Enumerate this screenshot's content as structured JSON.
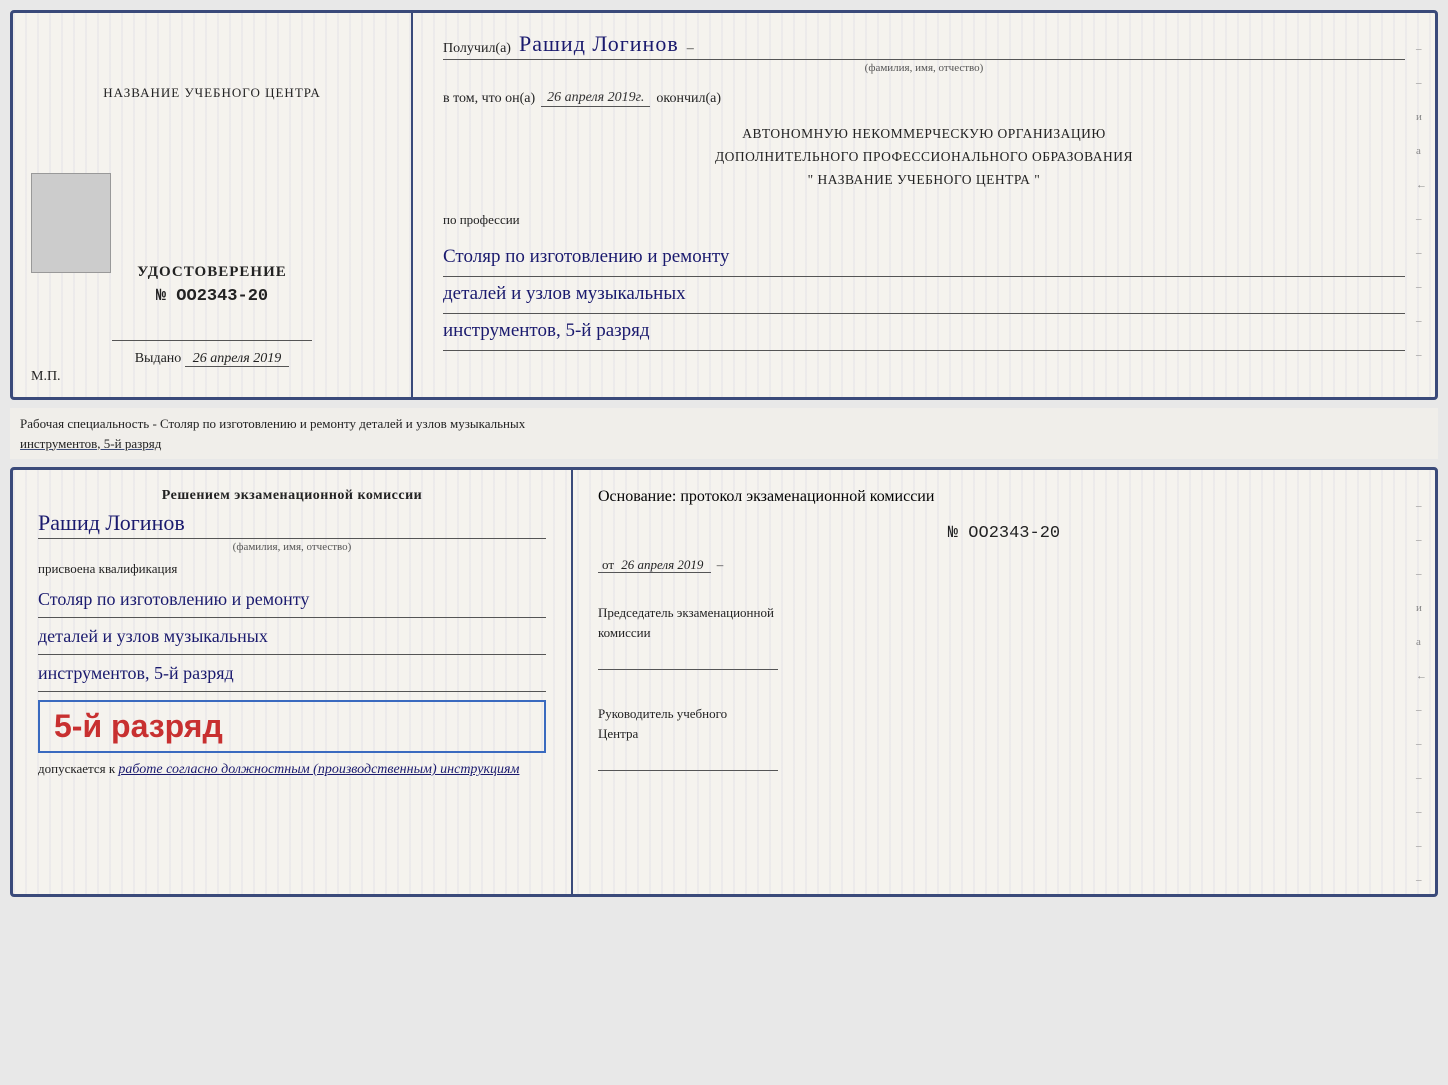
{
  "top_doc": {
    "left": {
      "center_title": "НАЗВАНИЕ УЧЕБНОГО ЦЕНТРА",
      "udostoverenie_label": "УДОСТОВЕРЕНИЕ",
      "number": "№ OO2343-20",
      "vydano_label": "Выдано",
      "vydano_date": "26 апреля 2019",
      "mp_label": "М.П."
    },
    "right": {
      "poluchil_prefix": "Получил(а)",
      "recipient_name": "Рашид Логинов",
      "fio_label": "(фамилия, имя, отчество)",
      "vtom_prefix": "в том, что он(а)",
      "date_value": "26 апреля 2019г.",
      "okonchil_label": "окончил(а)",
      "org_line1": "АВТОНОМНУЮ НЕКОММЕРЧЕСКУЮ ОРГАНИЗАЦИЮ",
      "org_line2": "ДОПОЛНИТЕЛЬНОГО ПРОФЕССИОНАЛЬНОГО ОБРАЗОВАНИЯ",
      "org_name": "\"  НАЗВАНИЕ УЧЕБНОГО ЦЕНТРА  \"",
      "po_professii": "по профессии",
      "profession_line1": "Столяр по изготовлению и ремонту",
      "profession_line2": "деталей и узлов музыкальных",
      "profession_line3": "инструментов, 5-й разряд"
    }
  },
  "separator": {
    "text": "Рабочая специальность - Столяр по изготовлению и ремонту деталей и узлов музыкальных",
    "text2": "инструментов, 5-й разряд"
  },
  "bottom_doc": {
    "left": {
      "resheniem_label": "Решением экзаменационной комиссии",
      "fio_name": "Рашид Логинов",
      "fio_sublabel": "(фамилия, имя, отчество)",
      "prisvoena_label": "присвоена квалификация",
      "qual_line1": "Столяр по изготовлению и ремонту",
      "qual_line2": "деталей и узлов музыкальных",
      "qual_line3": "инструментов, 5-й разряд",
      "rank_text": "5-й разряд",
      "dopuskaetsya_prefix": "допускается к",
      "dopuskaetsya_italic": "работе согласно должностным (производственным) инструкциям"
    },
    "right": {
      "osnovanie_label": "Основание: протокол экзаменационной комиссии",
      "number": "№  OO2343-20",
      "ot_prefix": "от",
      "ot_date": "26 апреля 2019",
      "predsedatel_line1": "Председатель экзаменационной",
      "predsedatel_line2": "комиссии",
      "rukovoditel_line1": "Руководитель учебного",
      "rukovoditel_line2": "Центра"
    }
  }
}
